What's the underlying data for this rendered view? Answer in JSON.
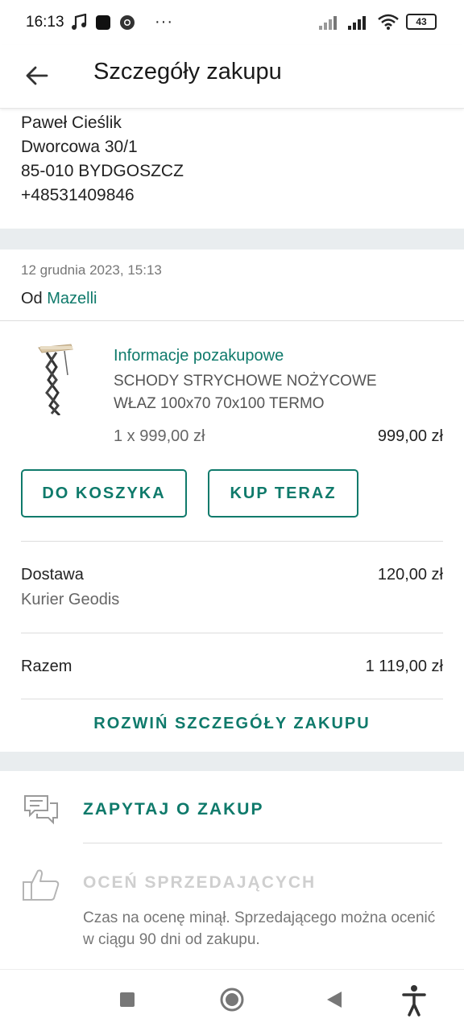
{
  "status_bar": {
    "time": "16:13",
    "battery": "43",
    "more": "···"
  },
  "app_bar": {
    "title": "Szczegóły zakupu"
  },
  "address": {
    "name": "Paweł Cieślik",
    "street": "Dworcowa 30/1",
    "city": "85-010 BYDGOSZCZ",
    "phone": "+48531409846"
  },
  "order": {
    "date": "12 grudnia 2023, 15:13",
    "from_label": "Od",
    "seller": "Mazelli"
  },
  "item": {
    "info_link": "Informacje pozakupowe",
    "name": "SCHODY STRYCHOWE NOŻYCOWE WŁAZ 100x70 70x100 TERMO",
    "quantity_price": "1 x 999,00 zł",
    "total": "999,00 zł",
    "add_to_cart": "DO KOSZYKA",
    "buy_now": "KUP TERAZ"
  },
  "delivery": {
    "label": "Dostawa",
    "method": "Kurier Geodis",
    "price": "120,00 zł"
  },
  "summary": {
    "label": "Razem",
    "value": "1 119,00 zł"
  },
  "expand_label": "ROZWIŃ SZCZEGÓŁY ZAKUPU",
  "actions": {
    "ask_label": "ZAPYTAJ O ZAKUP",
    "rate_label": "OCEŃ SPRZEDAJĄCYCH",
    "rate_desc": "Czas na ocenę minął. Sprzedającego można ocenić w ciągu 90 dni od zakupu."
  },
  "colors": {
    "accent": "#0f7a6b",
    "separator": "#e9edef"
  },
  "icons": [
    "back-arrow-icon",
    "chat-icon",
    "thumbs-up-icon",
    "nav-recents-icon",
    "nav-home-icon",
    "nav-back-icon",
    "accessibility-icon"
  ]
}
